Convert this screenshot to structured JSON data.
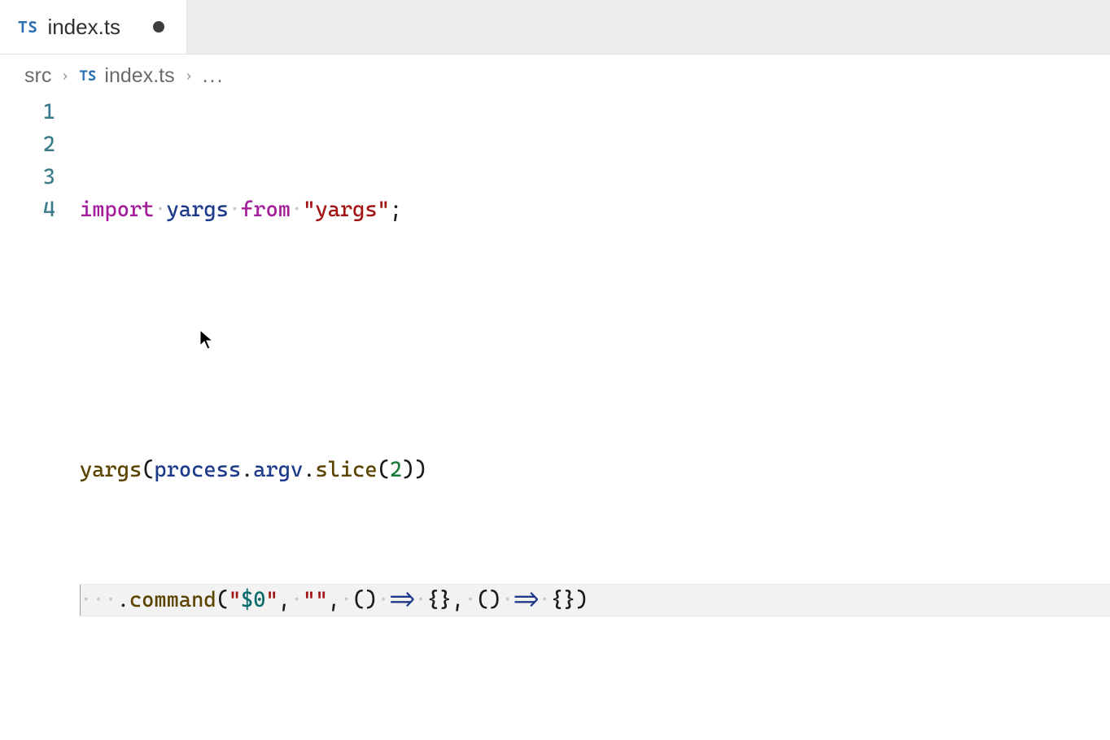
{
  "tab": {
    "icon_label": "TS",
    "filename": "index.ts",
    "dirty": true
  },
  "breadcrumbs": {
    "segments": [
      "src",
      "index.ts"
    ],
    "file_icon_label": "TS",
    "trailing": "..."
  },
  "editor": {
    "line_numbers": [
      "1",
      "2",
      "3",
      "4"
    ],
    "active_line_index": 3,
    "lines": {
      "l1": {
        "kw_import": "import",
        "ident_yargs": "yargs",
        "kw_from": "from",
        "str_module": "\"yargs\"",
        "semi": ";"
      },
      "l3": {
        "fn_yargs": "yargs",
        "lparen": "(",
        "ident_process": "process",
        "dot1": ".",
        "ident_argv": "argv",
        "dot2": ".",
        "fn_slice": "slice",
        "lparen2": "(",
        "num_two": "2",
        "rparen2": ")",
        "rparen": ")"
      },
      "l4": {
        "ws_dots": "···",
        "dot": ".",
        "fn_command": "command",
        "lparen": "(",
        "str_dollar0_open": "\"",
        "str_dollar0_val": "$0",
        "str_dollar0_close": "\"",
        "comma1": ",",
        "ws1": "·",
        "str_empty": "\"\"",
        "comma2": ",",
        "ws2": "·",
        "paren_empty1": "()",
        "ws3": "·",
        "arrow1": "=>",
        "ws4": "·",
        "braces1": "{}",
        "comma3": ",",
        "ws5": "·",
        "paren_empty2": "()",
        "ws6": "·",
        "arrow2": "=>",
        "ws7": "·",
        "braces2": "{}",
        "rparen": ")"
      }
    }
  }
}
